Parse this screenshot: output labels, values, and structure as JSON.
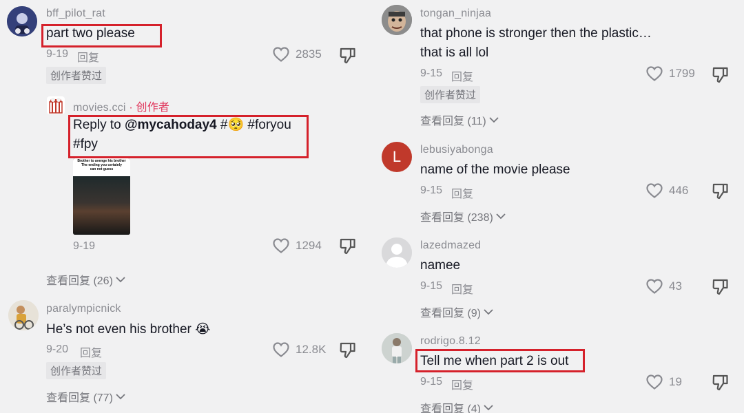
{
  "left": {
    "c1": {
      "username": "bff_pilot_rat",
      "text": "part two please",
      "date": "9-19",
      "reply": "回复",
      "likes": "2835",
      "badge": "创作者赞过"
    },
    "c2": {
      "username": "movies.cci",
      "separator": " · ",
      "creator_tag": "创作者",
      "reply_prefix": "Reply to ",
      "mention": "@mycahoday4",
      "hash1": " #",
      "emoji": "🥺",
      "hash2": " #foryou",
      "line2": "#fpy",
      "thumb_caption_1": "Brother to avenge his brother",
      "thumb_caption_2": "The ending you certainly",
      "thumb_caption_3": "can not guess",
      "date": "9-19",
      "likes": "1294"
    },
    "c2_view": "查看回复 (26)",
    "c3": {
      "username": "paralympicnick",
      "text": "He’s not even his brother",
      "emoji": "😭",
      "date": "9-20",
      "reply": "回复",
      "likes": "12.8K",
      "badge": "创作者赞过",
      "view": "查看回复 (77)"
    }
  },
  "right": {
    "c1": {
      "username": "tongan_ninjaa",
      "line1": "that phone is stronger then the plastic…",
      "line2": "that is all lol",
      "date": "9-15",
      "reply": "回复",
      "likes": "1799",
      "badge": "创作者赞过",
      "view": "查看回复 (11)"
    },
    "c2": {
      "username": "lebusiyabonga",
      "avatar_letter": "L",
      "text": "name of the movie please",
      "date": "9-15",
      "reply": "回复",
      "likes": "446",
      "view": "查看回复 (238)"
    },
    "c3": {
      "username": "lazedmazed",
      "text": "namee",
      "date": "9-15",
      "reply": "回复",
      "likes": "43",
      "view": "查看回复 (9)"
    },
    "c4": {
      "username": "rodrigo.8.12",
      "text": "Tell me when part 2 is out",
      "date": "9-15",
      "reply": "回复",
      "likes": "19",
      "view": "查看回复 (4)"
    }
  },
  "colors": {
    "highlight_box": "#d5212b",
    "creator_tag": "#e0345a",
    "avatar_L": "#c0392b"
  },
  "icons": [
    "heart-outline",
    "thumbs-down",
    "chevron-down"
  ]
}
